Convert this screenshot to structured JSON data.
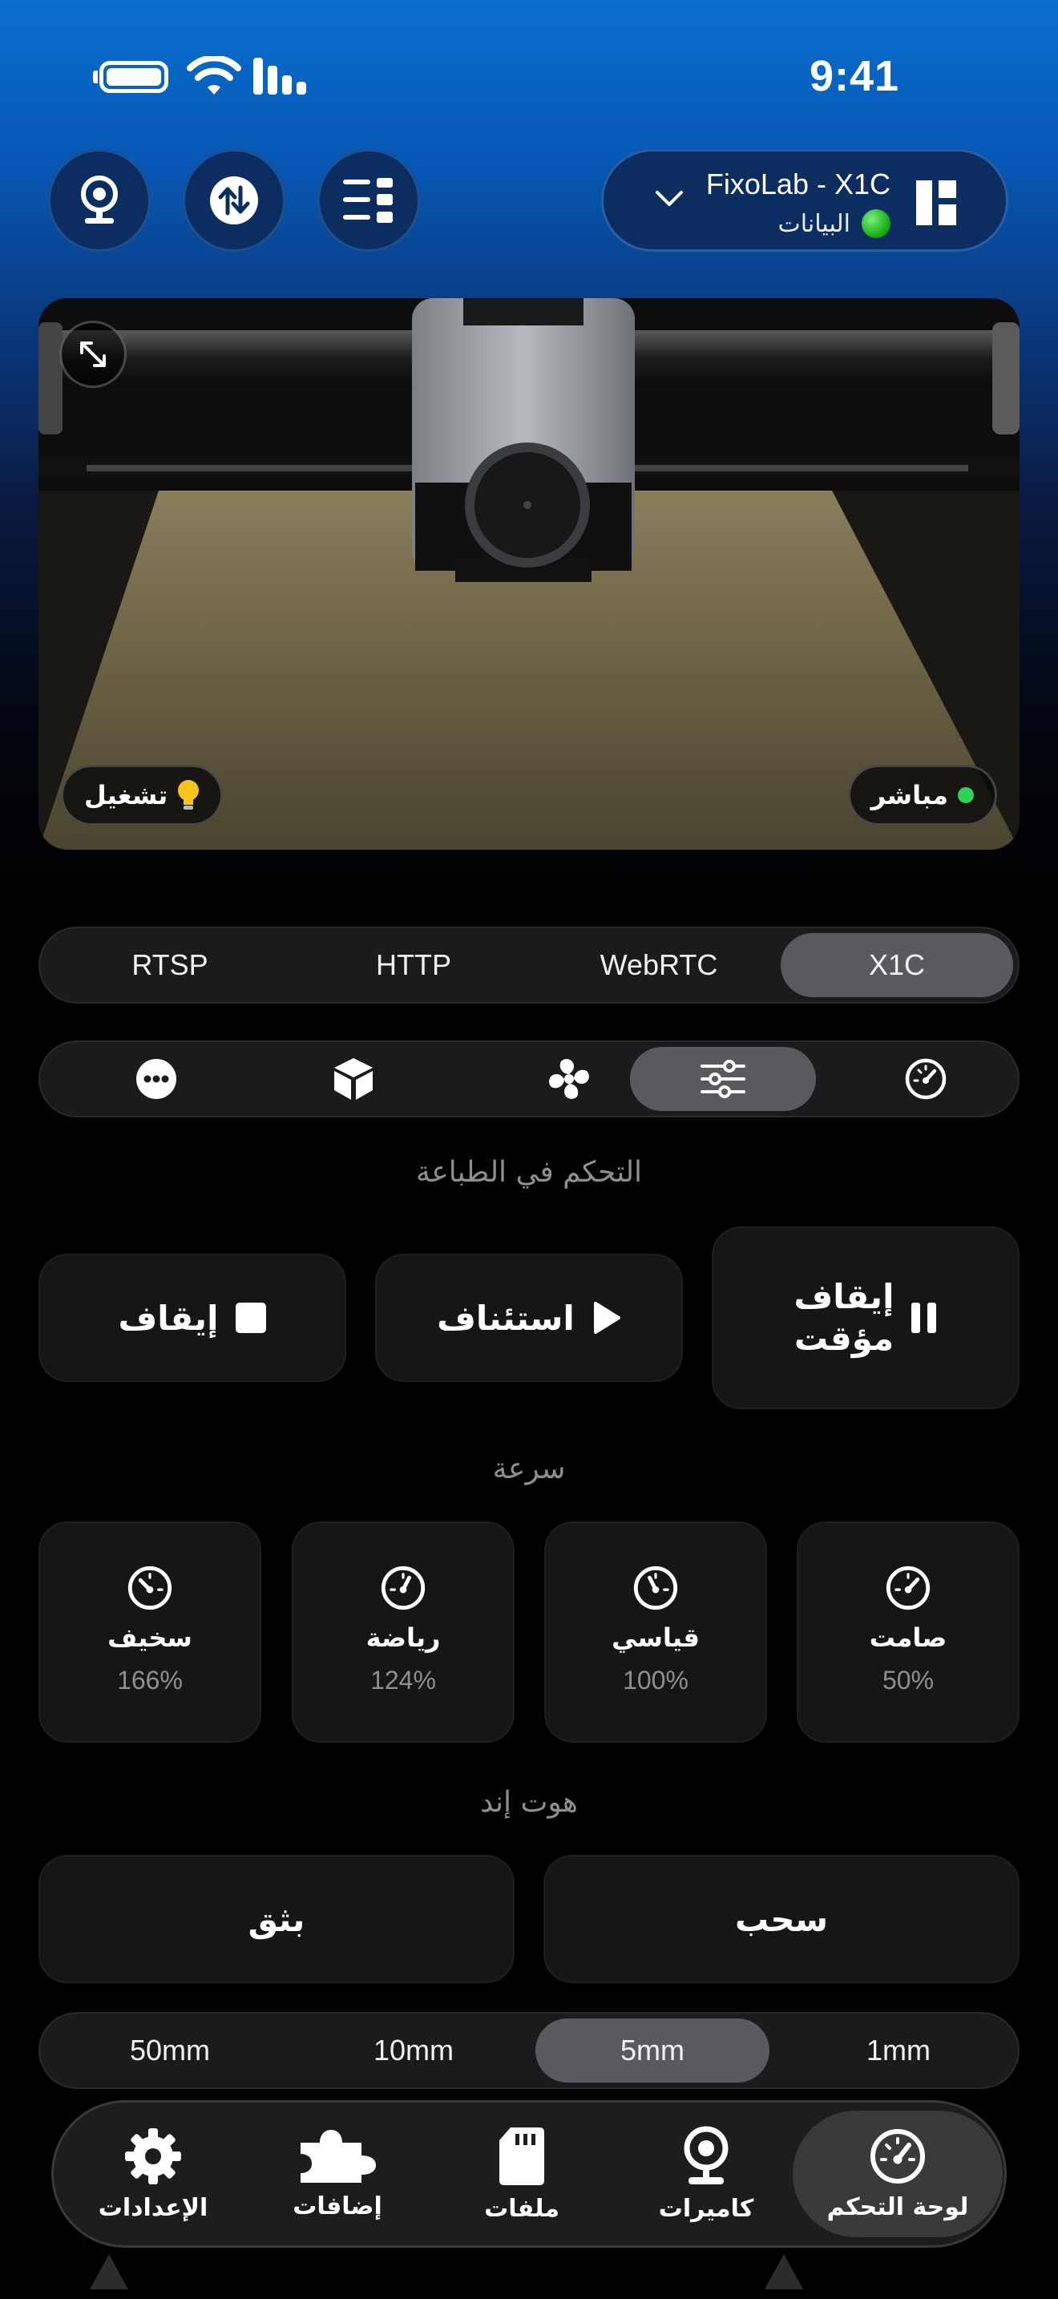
{
  "status_bar": {
    "time": "9:41"
  },
  "printer": {
    "name": "FixoLab - X1C",
    "status": "البيانات",
    "status_color": "#22c32a"
  },
  "camera": {
    "live_label": "مباشر",
    "light_label": "تشغيل",
    "live_color": "#30d158"
  },
  "stream_tabs": {
    "items": [
      "X1C",
      "WebRTC",
      "HTTP",
      "RTSP"
    ],
    "selected": "X1C"
  },
  "control_tabs": {
    "icons": [
      "speedometer-icon",
      "sliders-icon",
      "fan-icon",
      "box-icon",
      "more-icon"
    ],
    "selected": "sliders-icon"
  },
  "print_control": {
    "title": "التحكم في الطباعة",
    "pause_line1": "إيقاف",
    "pause_line2": "مؤقت",
    "resume": "استئناف",
    "stop": "إيقاف"
  },
  "speed": {
    "title": "سرعة",
    "modes": [
      {
        "name": "صامت",
        "value": "50%"
      },
      {
        "name": "قياسي",
        "value": "100%"
      },
      {
        "name": "رياضة",
        "value": "124%"
      },
      {
        "name": "سخيف",
        "value": "166%"
      }
    ]
  },
  "hotend": {
    "title": "هوت إند",
    "retract": "سحب",
    "extrude": "بثق",
    "distances": [
      "1mm",
      "5mm",
      "10mm",
      "50mm"
    ],
    "selected_distance": "5mm"
  },
  "tab_bar": {
    "items": [
      {
        "label": "لوحة التحكم",
        "icon": "dashboard-icon"
      },
      {
        "label": "كاميرات",
        "icon": "webcam-icon"
      },
      {
        "label": "ملفات",
        "icon": "sd-card-icon"
      },
      {
        "label": "إضافات",
        "icon": "puzzle-icon"
      },
      {
        "label": "الإعدادات",
        "icon": "gear-icon"
      }
    ],
    "selected": "لوحة التحكم"
  }
}
